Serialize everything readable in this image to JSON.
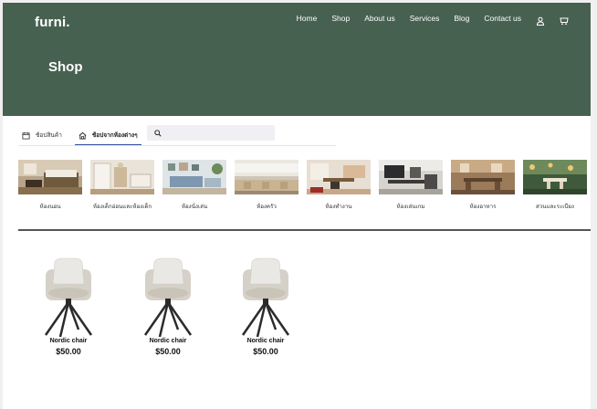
{
  "brand": {
    "logo": "furni."
  },
  "nav": {
    "items": [
      "Home",
      "Shop",
      "About us",
      "Services",
      "Blog",
      "Contact us"
    ],
    "user_icon": "user-icon",
    "cart_icon": "cart-icon"
  },
  "hero": {
    "title": "Shop",
    "bg_color": "#476151"
  },
  "tabs": {
    "items": [
      {
        "label": "ช้อปสินค้า",
        "icon": "calendar-icon",
        "active": false
      },
      {
        "label": "ช้อปจากห้องต่างๆ",
        "icon": "home-icon",
        "active": true
      }
    ],
    "accent": "#2f4fa0"
  },
  "search": {
    "placeholder": "",
    "value": ""
  },
  "rooms": [
    {
      "label": "ห้องนอน"
    },
    {
      "label": "ห้องเด็กอ่อนและห้องเด็ก"
    },
    {
      "label": "ห้องนั่งเล่น"
    },
    {
      "label": "ห้องครัว"
    },
    {
      "label": "ห้องทำงาน"
    },
    {
      "label": "ห้องเล่นเกม"
    },
    {
      "label": "ห้องอาหาร"
    },
    {
      "label": "สวนและระเบียง"
    }
  ],
  "products": [
    {
      "name": "Nordic chair",
      "price": "$50.00"
    },
    {
      "name": "Nordic chair",
      "price": "$50.00"
    },
    {
      "name": "Nordic chair",
      "price": "$50.00"
    }
  ]
}
